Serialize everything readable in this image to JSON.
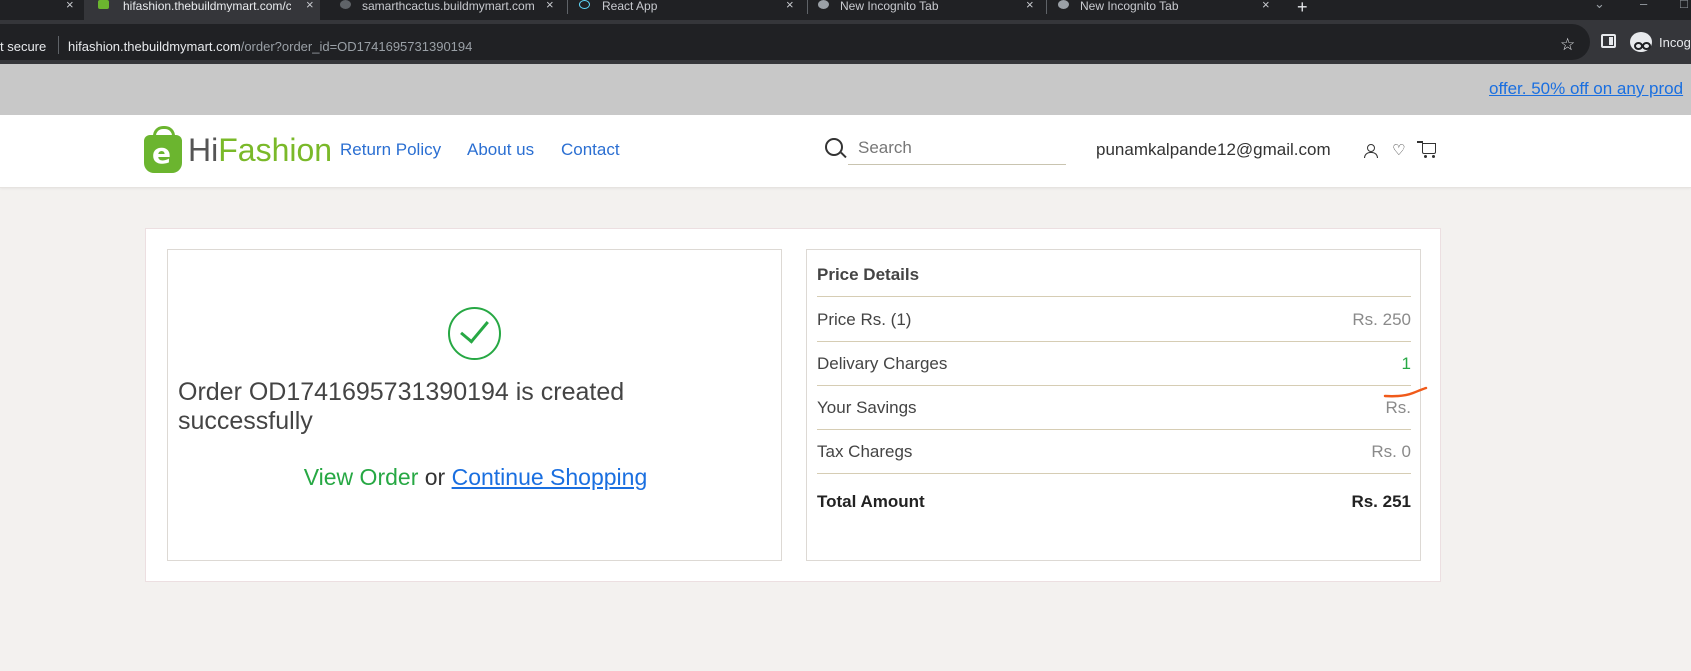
{
  "browser": {
    "tabs": [
      {
        "label": "hifashion.thebuildmymart.com/c",
        "active": true
      },
      {
        "label": "samarthcactus.buildmymart.com",
        "active": false
      },
      {
        "label": "React App",
        "active": false
      },
      {
        "label": "New Incognito Tab",
        "active": false
      },
      {
        "label": "New Incognito Tab",
        "active": false
      }
    ],
    "new_tab": "+",
    "close_glyph": "×",
    "security_label": "t secure",
    "url_host": "hifashion.thebuildmymart.com",
    "url_path": "/order?order_id=OD1741695731390194",
    "profile_label": "Incog"
  },
  "promo": {
    "text": "offer. 50% off on any prod"
  },
  "header": {
    "logo_e": "e",
    "logo_hi": "Hi",
    "logo_fashion": "Fashion",
    "nav": [
      "Return Policy",
      "About us",
      "Contact"
    ],
    "search_placeholder": "Search",
    "user_email": "punamkalpande12@gmail.com",
    "heart_glyph": "♡"
  },
  "order": {
    "message": "Order OD1741695731390194 is created successfully",
    "view_order": "View Order",
    "or": " or ",
    "continue_shopping": "Continue Shopping"
  },
  "price_details": {
    "title": "Price Details",
    "rows": [
      {
        "label": "Price Rs. (1)",
        "value": "Rs. 250"
      },
      {
        "label": "Delivary Charges",
        "value": "1"
      },
      {
        "label": "Your Savings",
        "value": "Rs."
      },
      {
        "label": "Tax Charegs",
        "value": "Rs. 0"
      }
    ],
    "total": {
      "label": "Total Amount",
      "value": "Rs. 251"
    }
  },
  "colors": {
    "brand_green": "#7ab929",
    "success_green": "#27a844",
    "link_blue": "#1a6fe0",
    "annotation_orange": "#f05a1a"
  }
}
